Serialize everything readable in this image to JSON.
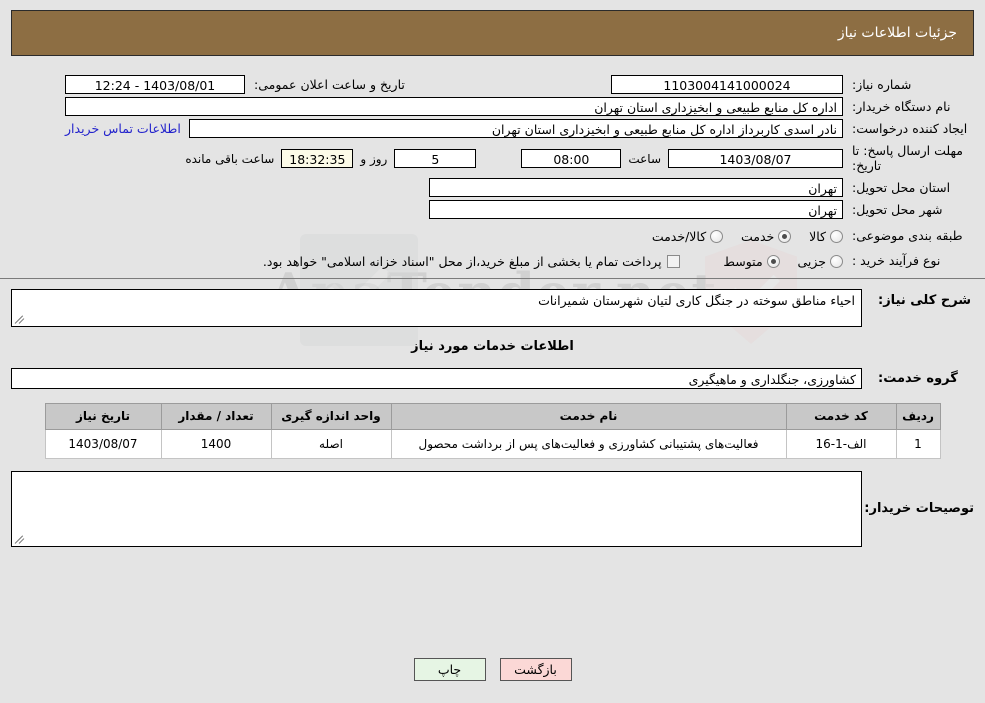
{
  "header": {
    "title": "جزئیات اطلاعات نیاز",
    "bg_color": "#8d6e43"
  },
  "watermark": {
    "text": "AnaTender.net"
  },
  "form": {
    "need_number_label": "شماره نیاز:",
    "need_number_value": "1103004141000024",
    "announce_datetime_label": "تاریخ و ساعت اعلان عمومی:",
    "announce_datetime_value": "1403/08/01 - 12:24",
    "buyer_org_label": "نام دستگاه خریدار:",
    "buyer_org_value": "اداره کل منابع طبیعی و ابخیزداری استان تهران",
    "requester_label": "ایجاد کننده درخواست:",
    "requester_value": "نادر اسدی کاربرداز اداره کل منابع طبیعی و ابخیزداری استان تهران",
    "contact_link": "اطلاعات تماس خریدار",
    "deadline_label": "مهلت ارسال پاسخ: تا تاریخ:",
    "deadline_date": "1403/08/07",
    "deadline_hour_label": "ساعت",
    "deadline_hour": "08:00",
    "remaining_days": "5",
    "remaining_days_label": "روز و",
    "remaining_time": "18:32:35",
    "remaining_time_label": "ساعت باقی مانده",
    "province_label": "استان محل تحویل:",
    "province_value": "تهران",
    "city_label": "شهر محل تحویل:",
    "city_value": "تهران",
    "category_label": "طبقه بندی موضوعی:",
    "category_options": [
      {
        "label": "کالا",
        "selected": false
      },
      {
        "label": "خدمت",
        "selected": true
      },
      {
        "label": "کالا/خدمت",
        "selected": false
      }
    ],
    "process_label": "نوع فرآیند خرید :",
    "process_options": [
      {
        "label": "جزیی",
        "selected": false
      },
      {
        "label": "متوسط",
        "selected": true
      }
    ],
    "treasury_checkbox_label": "پرداخت تمام یا بخشی از مبلغ خرید،از محل \"اسناد خزانه اسلامی\" خواهد بود.",
    "treasury_checked": false
  },
  "description": {
    "label": "شرح کلی نیاز:",
    "value": "احیاء مناطق سوخته در جنگل کاری لتیان شهرستان شمیرانات"
  },
  "services_section": {
    "heading": "اطلاعات خدمات مورد نیاز",
    "group_label": "گروه خدمت:",
    "group_value": "کشاورزی، جنگلداری و ماهیگیری"
  },
  "table": {
    "headers": [
      "ردیف",
      "کد خدمت",
      "نام خدمت",
      "واحد اندازه گیری",
      "تعداد / مقدار",
      "تاریخ نیاز"
    ],
    "rows": [
      {
        "row": "1",
        "code": "الف-1-16",
        "name": "فعالیت‌های پشتیبانی کشاورزی و فعالیت‌های پس از برداشت محصول",
        "unit": "اصله",
        "quantity": "1400",
        "date": "1403/08/07"
      }
    ]
  },
  "buyer_notes": {
    "label": "توصیحات خریدار:",
    "value": ""
  },
  "buttons": {
    "print": "چاپ",
    "back": "بازگشت"
  }
}
